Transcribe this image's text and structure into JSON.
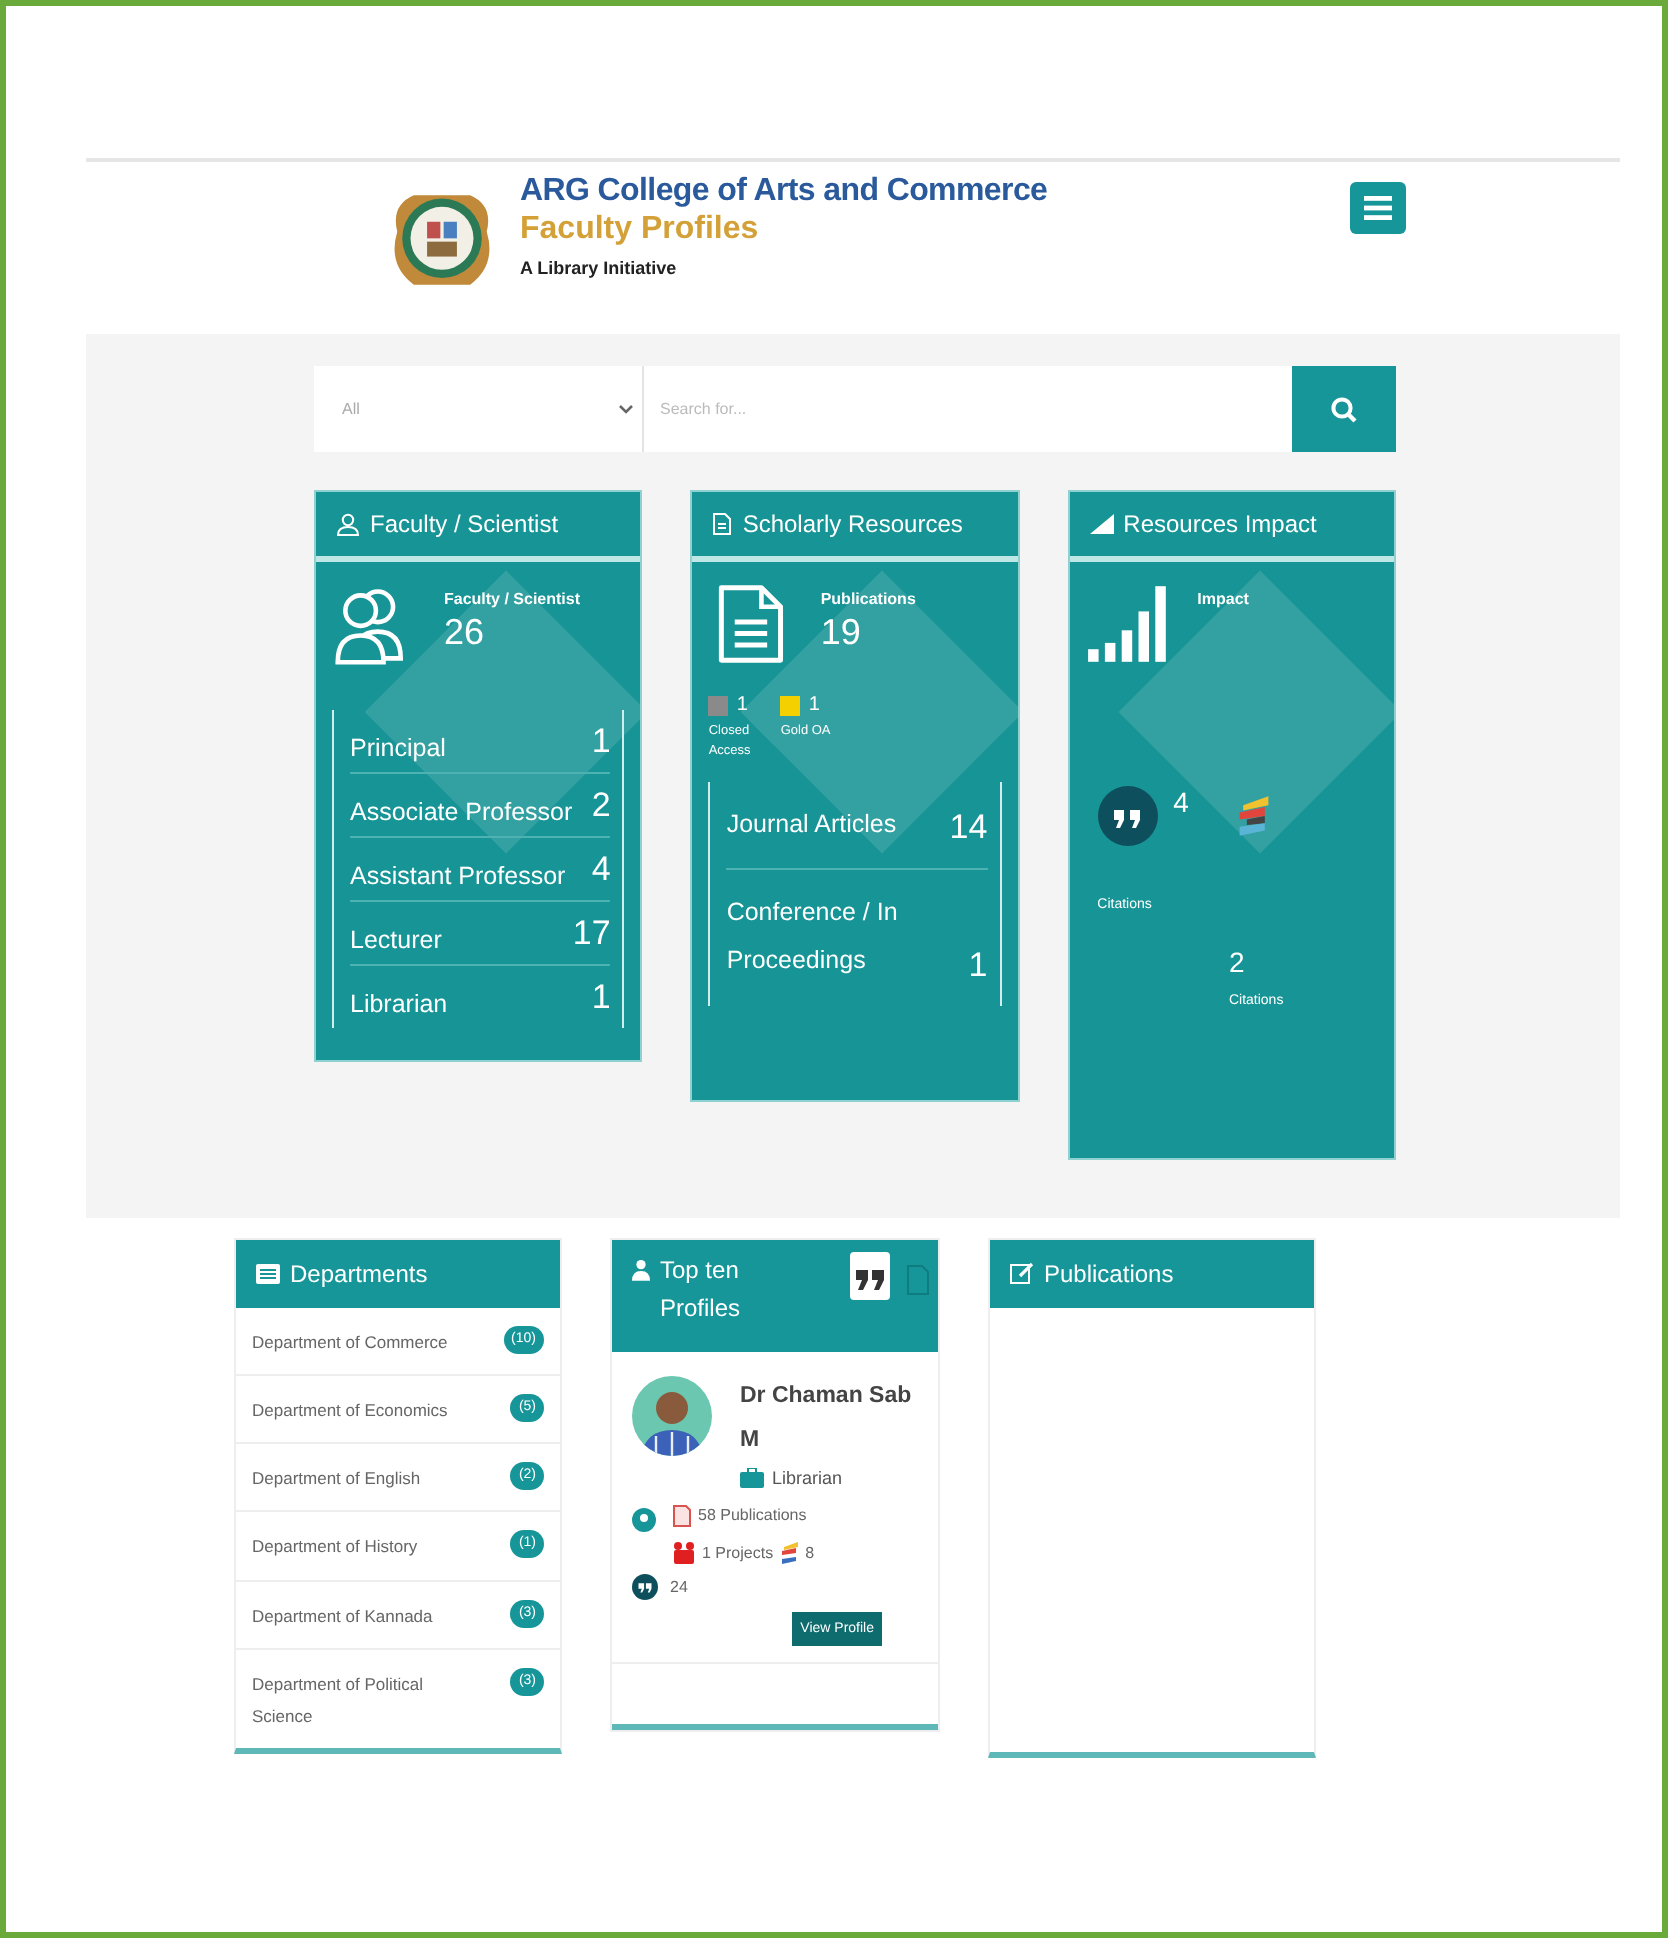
{
  "header": {
    "college": "ARG College of Arts and Commerce",
    "title": "Faculty Profiles",
    "tagline": "A Library Initiative"
  },
  "search": {
    "category": "All",
    "placeholder": "Search for..."
  },
  "faculty_card": {
    "title": "Faculty / Scientist",
    "stat_label": "Faculty / Scientist",
    "stat_value": "26",
    "rows": [
      {
        "label": "Principal",
        "count": "1"
      },
      {
        "label": "Associate Professor",
        "count": "2"
      },
      {
        "label": "Assistant Professor",
        "count": "4"
      },
      {
        "label": "Lecturer",
        "count": "17"
      },
      {
        "label": "Librarian",
        "count": "1"
      }
    ]
  },
  "resources_card": {
    "title": "Scholarly Resources",
    "stat_label": "Publications",
    "stat_value": "19",
    "access": [
      {
        "count": "1",
        "label": "Closed Access",
        "color": "#8a8a8a"
      },
      {
        "count": "1",
        "label": "Gold OA",
        "color": "#f5d000"
      }
    ],
    "rows": [
      {
        "label": "Journal Articles",
        "count": "14"
      },
      {
        "label": "Conference / In Proceedings",
        "count": "1"
      }
    ]
  },
  "impact_card": {
    "title": "Resources Impact",
    "stat_label": "Impact",
    "metrics": [
      {
        "kind": "quote",
        "value": "4",
        "label": "Citations"
      },
      {
        "kind": "stripes",
        "value": "2",
        "label": "Citations"
      }
    ]
  },
  "departments": {
    "title": "Departments",
    "items": [
      {
        "name": "Department of Commerce",
        "count": "(10)"
      },
      {
        "name": "Department of Economics",
        "count": "(5)"
      },
      {
        "name": "Department of English",
        "count": "(2)"
      },
      {
        "name": "Department of History",
        "count": "(1)"
      },
      {
        "name": "Department of Kannada",
        "count": "(3)"
      },
      {
        "name": "Department of Political Science",
        "count": "(3)"
      }
    ]
  },
  "top_profiles": {
    "title": "Top ten Profiles",
    "tabs": [
      {
        "kind": "quote",
        "selected": true
      },
      {
        "kind": "document",
        "selected": false
      }
    ],
    "profile": {
      "name": "Dr Chaman Sab M",
      "role": "Librarian",
      "publications": "58 Publications",
      "projects": "1 Projects",
      "stripes": "8",
      "citations": "24",
      "button": "View Profile"
    }
  },
  "publications": {
    "title": "Publications"
  }
}
